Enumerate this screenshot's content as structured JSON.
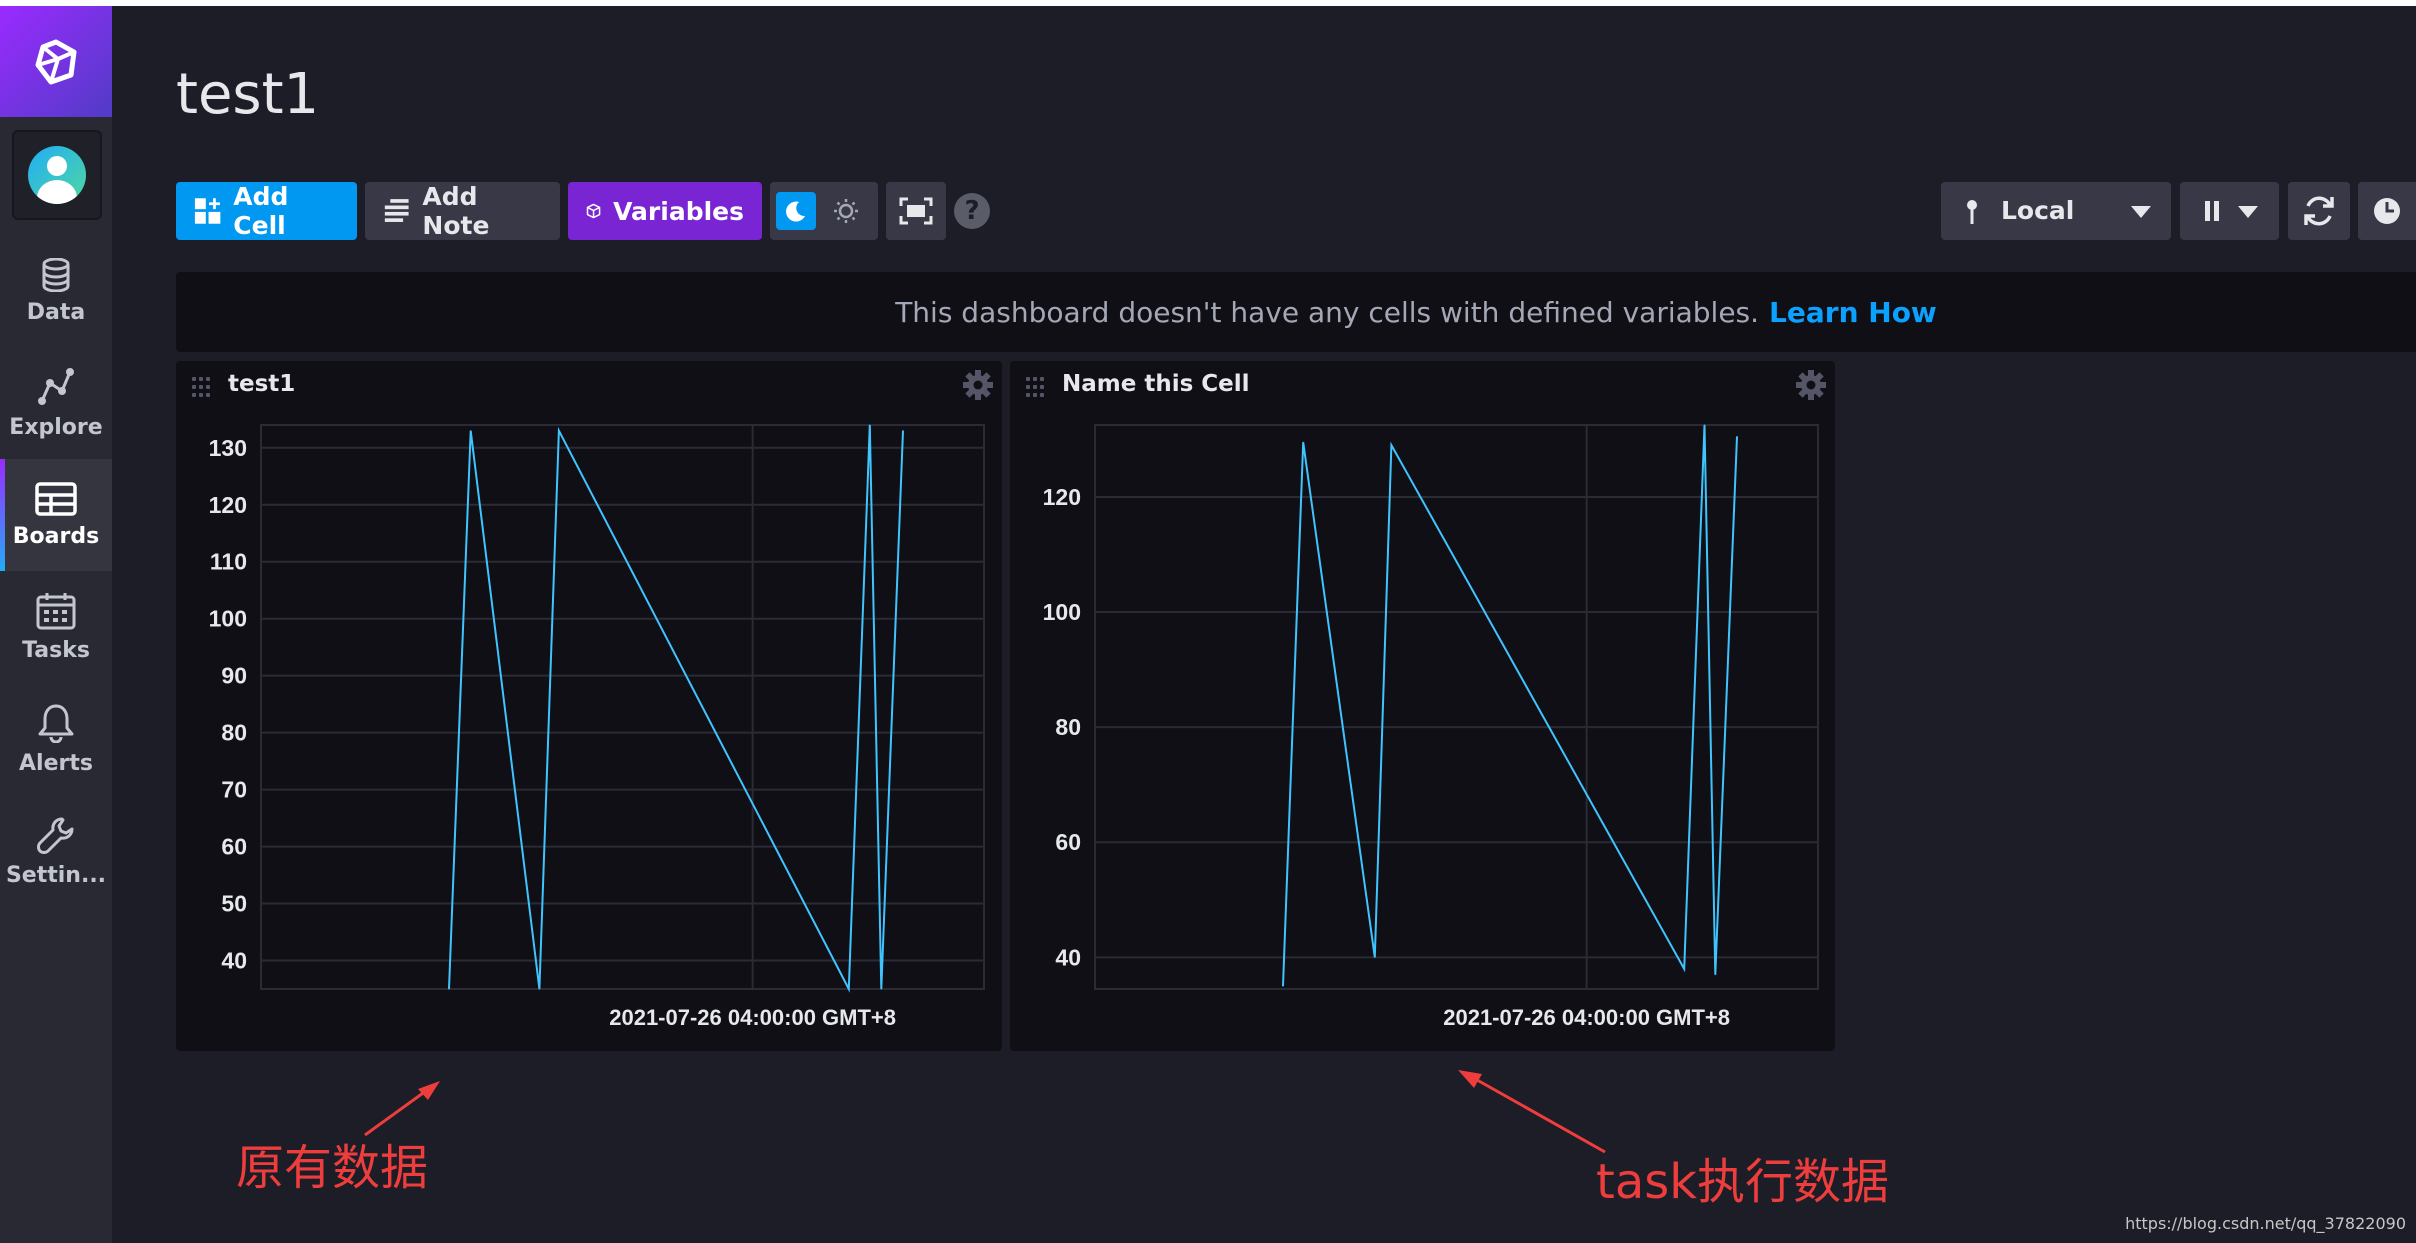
{
  "sidebar": {
    "items": [
      {
        "label": "Data",
        "icon": "database-icon"
      },
      {
        "label": "Explore",
        "icon": "graph-icon"
      },
      {
        "label": "Boards",
        "icon": "dashboard-icon",
        "active": true
      },
      {
        "label": "Tasks",
        "icon": "calendar-icon"
      },
      {
        "label": "Alerts",
        "icon": "bell-icon"
      },
      {
        "label": "Settin...",
        "icon": "wrench-icon"
      }
    ]
  },
  "page": {
    "title": "test1"
  },
  "toolbar": {
    "add_cell_label": "Add Cell",
    "add_note_label": "Add Note",
    "variables_label": "Variables",
    "timezone": "Local",
    "help_label": "?"
  },
  "banner": {
    "text": "This dashboard doesn't have any cells with defined variables.",
    "link": "Learn How"
  },
  "cells": [
    {
      "title": "test1",
      "chart_data": {
        "type": "line",
        "xlabel": "2021-07-26 04:00:00 GMT+8",
        "yticks": [
          40,
          50,
          60,
          70,
          80,
          90,
          100,
          110,
          120,
          130
        ],
        "ylim": [
          35,
          134
        ],
        "points": [
          [
            0.26,
            35
          ],
          [
            0.29,
            133
          ],
          [
            0.385,
            35
          ],
          [
            0.412,
            133
          ],
          [
            0.813,
            35
          ],
          [
            0.842,
            134
          ],
          [
            0.858,
            35
          ],
          [
            0.888,
            133
          ]
        ]
      }
    },
    {
      "title": "Name this Cell",
      "chart_data": {
        "type": "line",
        "xlabel": "2021-07-26 04:00:00 GMT+8",
        "yticks": [
          40,
          60,
          80,
          100,
          120
        ],
        "ylim": [
          34.5,
          132.5
        ],
        "points": [
          [
            0.26,
            35
          ],
          [
            0.288,
            129.5
          ],
          [
            0.387,
            40
          ],
          [
            0.41,
            129
          ],
          [
            0.815,
            38
          ],
          [
            0.843,
            132.5
          ],
          [
            0.858,
            37
          ],
          [
            0.888,
            130.5
          ]
        ]
      }
    }
  ],
  "annotations": {
    "left": "原有数据",
    "right": "task执行数据"
  },
  "watermark": "https://blog.csdn.net/qq_37822090",
  "colors": {
    "accent_blue": "#0098f0",
    "accent_purple": "#7a25d3",
    "line": "#40c4ff",
    "annotation": "#ee3d3d"
  }
}
